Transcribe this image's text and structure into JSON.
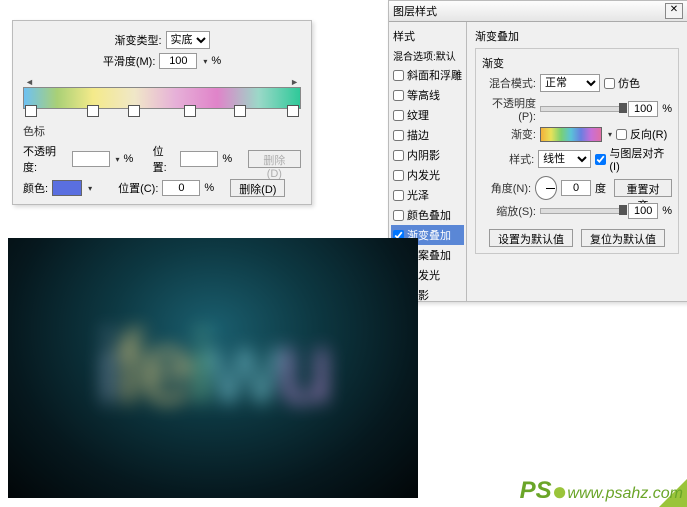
{
  "gradient_editor": {
    "type_label": "渐变类型:",
    "type_value": "实底",
    "smoothness_label": "平滑度(M):",
    "smoothness_value": "100",
    "percent": "%",
    "stops_section": "色标",
    "opacity_label": "不透明度:",
    "opacity_value": "",
    "position1_label": "位置:",
    "position1_value": "",
    "delete1": "删除(D)",
    "color_label": "颜色:",
    "color_swatch": "#5a6fe0",
    "position2_label": "位置(C):",
    "position2_value": "0",
    "delete2": "删除(D)"
  },
  "layer_style": {
    "title": "图层样式",
    "list_header": "样式",
    "blend_default": "混合选项:默认",
    "items": [
      {
        "label": "斜面和浮雕",
        "checked": false
      },
      {
        "label": "等高线",
        "checked": false
      },
      {
        "label": "纹理",
        "checked": false
      },
      {
        "label": "描边",
        "checked": false
      },
      {
        "label": "内阴影",
        "checked": false
      },
      {
        "label": "内发光",
        "checked": false
      },
      {
        "label": "光泽",
        "checked": false
      },
      {
        "label": "颜色叠加",
        "checked": false
      },
      {
        "label": "渐变叠加",
        "checked": true,
        "selected": true
      },
      {
        "label": "图案叠加",
        "checked": false
      },
      {
        "label": "外发光",
        "checked": false
      },
      {
        "label": "投影",
        "checked": false
      }
    ],
    "panel": {
      "group": "渐变叠加",
      "subgroup": "渐变",
      "blend_mode_label": "混合模式:",
      "blend_mode_value": "正常",
      "dither_label": "仿色",
      "opacity_label": "不透明度(P):",
      "opacity_value": "100",
      "percent": "%",
      "gradient_label": "渐变:",
      "reverse_label": "反向(R)",
      "style_label": "样式:",
      "style_value": "线性",
      "align_label": "与图层对齐(I)",
      "angle_label": "角度(N):",
      "angle_value": "0",
      "angle_unit": "度",
      "reset_align": "重置对齐",
      "scale_label": "缩放(S):",
      "scale_value": "100",
      "set_default": "设置为默认值",
      "reset_default": "复位为默认值"
    }
  },
  "preview_text": "ifeiwu",
  "preview_colors": [
    "#7a8fa8",
    "#c4b87a",
    "#c4b87a",
    "#6fb88f",
    "#6fb8c4",
    "#a87fc4"
  ],
  "watermark": {
    "brand": "PS",
    "url": "www.psahz.com"
  }
}
